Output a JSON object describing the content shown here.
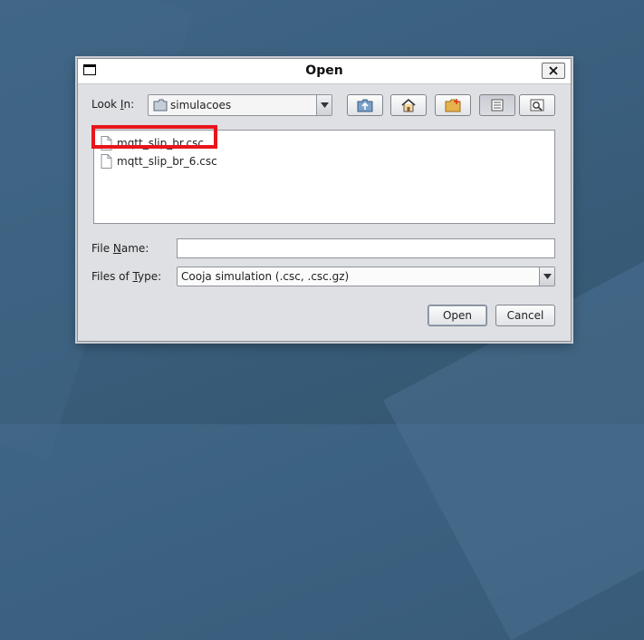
{
  "dialog": {
    "title": "Open",
    "close_label": "X"
  },
  "look_in": {
    "label_pre": "Look ",
    "label_mnemonic": "I",
    "label_post": "n:",
    "value": "simulacoes"
  },
  "toolbar": {
    "buttons": [
      {
        "name": "up-one-level-icon"
      },
      {
        "name": "home-icon"
      },
      {
        "name": "new-folder-icon"
      },
      {
        "name": "list-view-icon"
      },
      {
        "name": "details-view-icon"
      }
    ]
  },
  "files": [
    {
      "name": "mqtt_slip_br.csc",
      "highlighted": true
    },
    {
      "name": "mqtt_slip_br_6.csc",
      "highlighted": false
    }
  ],
  "file_name": {
    "label_pre": "File ",
    "label_mnemonic": "N",
    "label_post": "ame:",
    "value": ""
  },
  "files_of_type": {
    "label_pre": "Files of ",
    "label_mnemonic": "T",
    "label_post": "ype:",
    "value": "Cooja simulation (.csc, .csc.gz)"
  },
  "buttons": {
    "open": "Open",
    "cancel": "Cancel"
  },
  "colors": {
    "highlight_border": "#e8151b",
    "desktop": "#3f6585"
  }
}
